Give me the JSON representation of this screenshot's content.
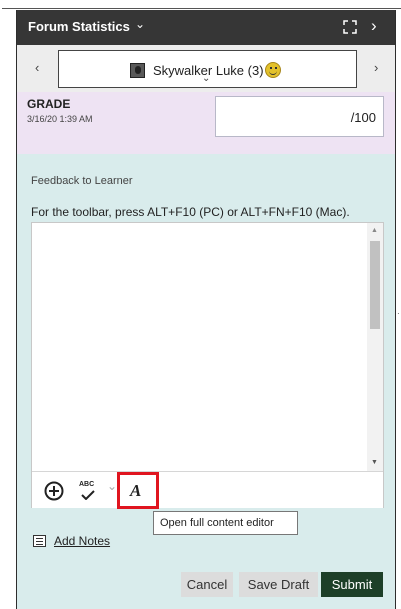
{
  "header": {
    "title": "Forum Statistics",
    "title_caret": "⌄",
    "next_glyph": "›"
  },
  "nav": {
    "prev_glyph": "‹",
    "next_glyph": "›",
    "learner": {
      "name": "Skywalker Luke (3)",
      "caret": "⌄"
    }
  },
  "grade": {
    "label": "GRADE",
    "date": "3/16/20 1:39 AM",
    "value": "",
    "max": "/100"
  },
  "feedback": {
    "label": "Feedback to Learner",
    "toolbar_hint": "For the toolbar, press ALT+F10 (PC) or ALT+FN+F10 (Mac).",
    "content": ""
  },
  "editor_toolbar": {
    "spellcheck_label": "ABC",
    "full_editor_glyph": "A",
    "tooltip": "Open full content editor"
  },
  "notes": {
    "add_label": "Add Notes"
  },
  "actions": {
    "cancel": "Cancel",
    "save_draft": "Save Draft",
    "submit": "Submit"
  },
  "colors": {
    "header_bg": "#363636",
    "grade_bg": "#eee3f3",
    "panel_bg": "#d9ecec",
    "submit_bg": "#1d3f28",
    "highlight": "#e0151f"
  }
}
